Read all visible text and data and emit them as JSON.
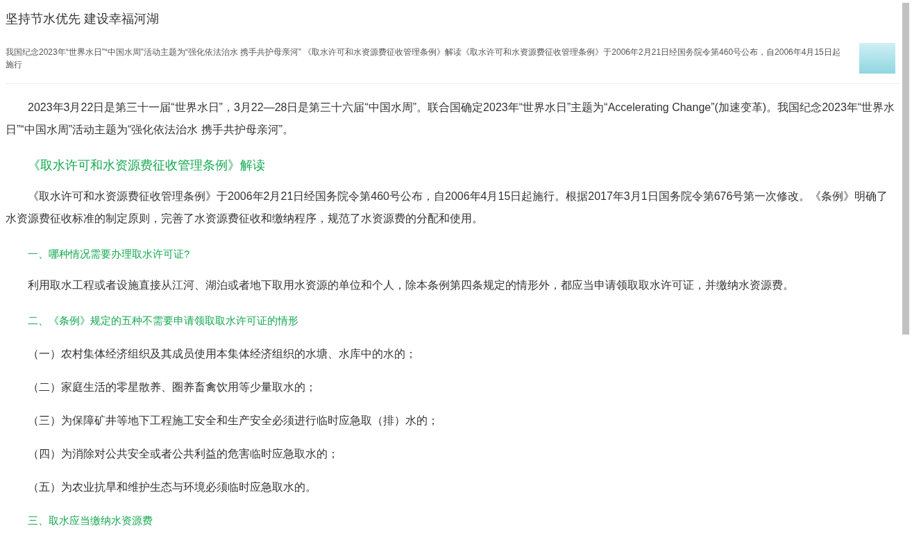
{
  "article": {
    "title": "坚持节水优先 建设幸福河湖",
    "summary": "我国纪念2023年“世界水日”“中国水周”活动主题为“强化依法治水 携手共护母亲河” 《取水许可和水资源费征收管理条例》解读《取水许可和水资源费征收管理条例》于2006年2月21日经国务院令第460号公布，自2006年4月15日起施行"
  },
  "blocks": [
    {
      "kind": "para",
      "text": "2023年3月22日是第三十一届“世界水日”，3月22—28日是第三十六届“中国水周”。联合国确定2023年“世界水日”主题为“Accelerating Change”(加速变革)。我国纪念2023年“世界水日”“中国水周”活动主题为“强化依法治水 携手共护母亲河”。"
    },
    {
      "kind": "title",
      "text": "《取水许可和水资源费征收管理条例》解读"
    },
    {
      "kind": "para",
      "text": "《取水许可和水资源费征收管理条例》于2006年2月21日经国务院令第460号公布，自2006年4月15日起施行。根据2017年3月1日国务院令第676号第一次修改。《条例》明确了水资源费征收标准的制定原则，完善了水资源费征收和缴纳程序，规范了水资源费的分配和使用。"
    },
    {
      "kind": "heading",
      "text": "一、哪种情况需要办理取水许可证?"
    },
    {
      "kind": "para",
      "text": "利用取水工程或者设施直接从江河、湖泊或者地下取用水资源的单位和个人，除本条例第四条规定的情形外，都应当申请领取取水许可证，并缴纳水资源费。"
    },
    {
      "kind": "heading",
      "text": "二、《条例》规定的五种不需要申请领取取水许可证的情形"
    },
    {
      "kind": "item",
      "text": "（一）农村集体经济组织及其成员使用本集体经济组织的水塘、水库中的水的；"
    },
    {
      "kind": "item",
      "text": "（二）家庭生活的零星散养、圈养畜禽饮用等少量取水的；"
    },
    {
      "kind": "item",
      "text": "（三）为保障矿井等地下工程施工安全和生产安全必须进行临时应急取（排）水的；"
    },
    {
      "kind": "item",
      "text": "（四）为消除对公共安全或者公共利益的危害临时应急取水的；"
    },
    {
      "kind": "item",
      "text": "（五）为农业抗旱和维护生态与环境必须临时应急取水的。"
    },
    {
      "kind": "heading",
      "text": "三、取水应当缴纳水资源费"
    }
  ]
}
